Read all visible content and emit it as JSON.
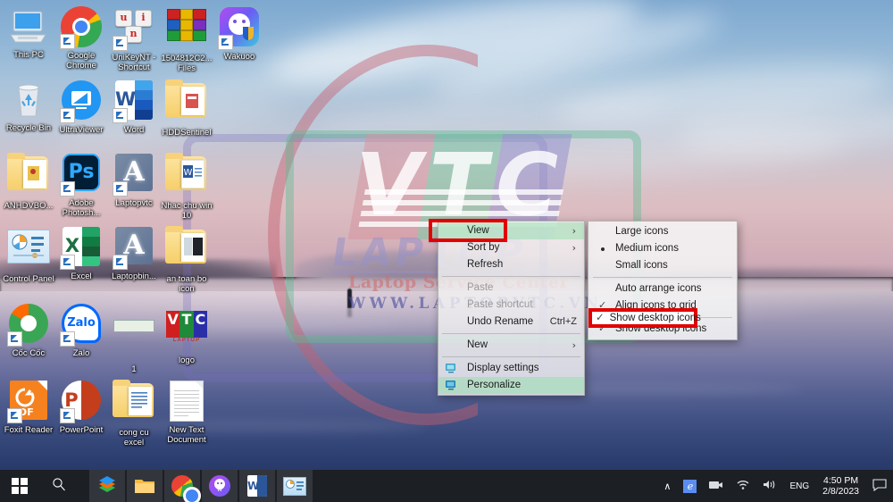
{
  "desktop": {
    "icons": [
      {
        "label": "This PC",
        "icon": "this-pc-icon"
      },
      {
        "label": "Google Chrome",
        "icon": "chrome-icon"
      },
      {
        "label": "UniKeyNT - Shortcut",
        "icon": "unikey-icon"
      },
      {
        "label": "1504812C2... Files",
        "icon": "winrar-archive-icon"
      },
      {
        "label": "Wakuoo",
        "icon": "wakuoo-icon"
      },
      {
        "label": "Recycle Bin",
        "icon": "recycle-bin-icon"
      },
      {
        "label": "UltraViewer",
        "icon": "ultraviewer-icon"
      },
      {
        "label": "Word",
        "icon": "word-icon"
      },
      {
        "label": "HDDSentinel",
        "icon": "folder-icon"
      },
      {
        "label": "ANHDVBO...",
        "icon": "folder-icon"
      },
      {
        "label": "Adobe Photosh...",
        "icon": "photoshop-icon"
      },
      {
        "label": "Laptopvtc",
        "icon": "font-file-icon"
      },
      {
        "label": "Nhac chu win 10",
        "icon": "folder-word-icon"
      },
      {
        "label": "Control Panel",
        "icon": "control-panel-icon"
      },
      {
        "label": "Excel",
        "icon": "excel-icon"
      },
      {
        "label": "Laptopbin...",
        "icon": "font-file-icon"
      },
      {
        "label": "an toan bo icon",
        "icon": "folder-icon"
      },
      {
        "label": "Cốc Cốc",
        "icon": "coccoc-icon"
      },
      {
        "label": "Zalo",
        "icon": "zalo-icon"
      },
      {
        "label": "1",
        "icon": "image-file-icon"
      },
      {
        "label": "logo",
        "icon": "vtc-logo-icon"
      },
      {
        "label": "Foxit Reader",
        "icon": "foxit-pdf-icon"
      },
      {
        "label": "PowerPoint",
        "icon": "powerpoint-icon"
      },
      {
        "label": "cong cu excel",
        "icon": "folder-excel-icon"
      },
      {
        "label": "New Text Document",
        "icon": "text-document-icon"
      }
    ]
  },
  "watermark": {
    "letters": "VTC",
    "word": "LAPTOP",
    "tagline": "Laptop Service Center",
    "url": "WWW.LAPTOPVTC.VN"
  },
  "context_menu": {
    "items": [
      {
        "label": "View",
        "arrow": "›",
        "accel": "",
        "state": "highlighted",
        "icon": ""
      },
      {
        "label": "Sort by",
        "arrow": "›",
        "accel": "",
        "state": "normal",
        "icon": ""
      },
      {
        "label": "Refresh",
        "arrow": "",
        "accel": "",
        "state": "normal",
        "icon": ""
      },
      {
        "label": "Paste",
        "arrow": "",
        "accel": "",
        "state": "disabled",
        "icon": ""
      },
      {
        "label": "Paste shortcut",
        "arrow": "",
        "accel": "",
        "state": "disabled",
        "icon": ""
      },
      {
        "label": "Undo Rename",
        "arrow": "",
        "accel": "Ctrl+Z",
        "state": "normal",
        "icon": ""
      },
      {
        "label": "New",
        "arrow": "›",
        "accel": "",
        "state": "normal",
        "icon": ""
      },
      {
        "label": "Display settings",
        "arrow": "",
        "accel": "",
        "state": "normal",
        "icon": "display-settings-icon"
      },
      {
        "label": "Personalize",
        "arrow": "",
        "accel": "",
        "state": "hover",
        "icon": "personalize-icon"
      }
    ]
  },
  "submenu": {
    "items": [
      {
        "label": "Large icons",
        "mark": ""
      },
      {
        "label": "Medium icons",
        "mark": "bullet"
      },
      {
        "label": "Small icons",
        "mark": ""
      },
      {
        "label": "Auto arrange icons",
        "mark": ""
      },
      {
        "label": "Align icons to grid",
        "mark": "check"
      },
      {
        "label": "Show desktop icons",
        "mark": "check"
      }
    ]
  },
  "annotations": {
    "box_color": "#e20000",
    "targets": [
      "View",
      "Show desktop icons"
    ]
  },
  "taskbar": {
    "start_label": "Start",
    "search_label": "Search",
    "apps": [
      {
        "name": "bluestacks-icon"
      },
      {
        "name": "file-explorer-icon"
      },
      {
        "name": "chrome-icon"
      },
      {
        "name": "wakuoo-icon"
      },
      {
        "name": "word-icon"
      },
      {
        "name": "control-panel-icon"
      }
    ],
    "tray": {
      "overflow": "∧",
      "icons": [
        "ie-icon",
        "ultraviewer-icon",
        "wifi-icon",
        "volume-icon"
      ],
      "language": "ENG",
      "time": "4:50 PM",
      "date": "2/8/2023",
      "action_center": "notification-icon"
    }
  }
}
